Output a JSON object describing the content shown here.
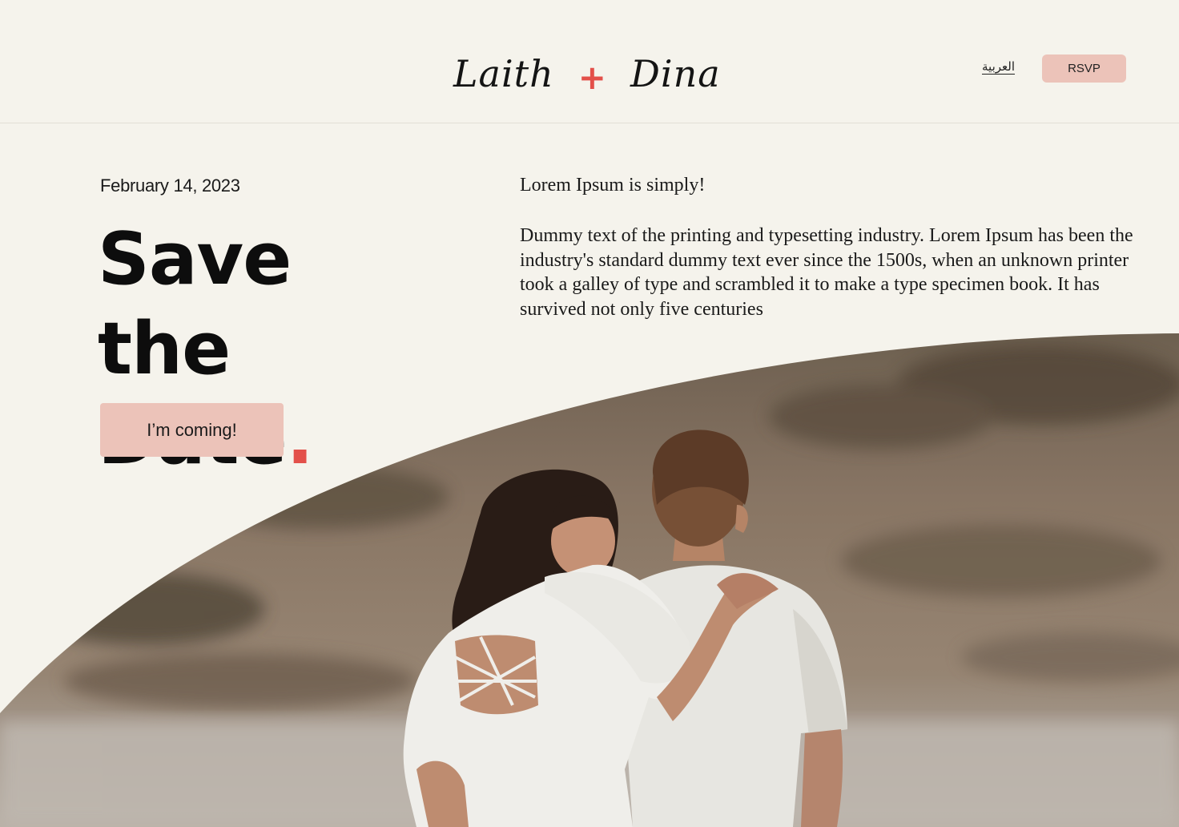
{
  "header": {
    "logo_first": "Laith",
    "logo_plus": "+",
    "logo_second": "Dina",
    "lang_link": "العربية",
    "rsvp_label": "RSVP"
  },
  "hero": {
    "date": "February 14, 2023",
    "headline_line1": "Save the",
    "headline_line2": "Date",
    "headline_dot": ".",
    "cta_label": "I’m coming!"
  },
  "content": {
    "intro": "Lorem Ipsum is simply!",
    "body": "Dummy text of the printing and typesetting industry. Lorem Ipsum has been the industry's standard dummy text ever since the 1500s, when an unknown printer took a galley of type and scrambled it to make a type specimen book. It has survived not only five centuries"
  },
  "colors": {
    "background": "#f5f3ec",
    "accent": "#e3504a",
    "button": "#ecc3b9"
  },
  "images": {
    "couple_photo": "couple-on-beach-photo"
  }
}
